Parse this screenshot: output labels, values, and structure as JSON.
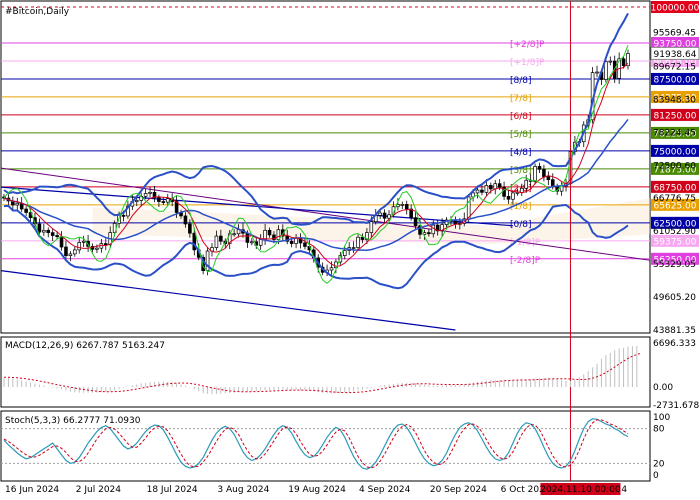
{
  "chart_data": [
    {
      "type": "candlestick",
      "title": "#Bitcoin,Daily",
      "yaxis_ticks": [
        43881.35,
        49605.2,
        55329.05,
        61052.9,
        66776.75,
        72500.6,
        78224.45,
        83948.3,
        89672.15,
        95569.45
      ],
      "current_price_label": "91938.64",
      "murrey_levels": [
        {
          "price": 100000.0,
          "label": "100000.00",
          "color": "#e0001b",
          "style": "dashed"
        },
        {
          "price": 93750.0,
          "label": "93750.00",
          "tag": "[+2/8]P",
          "color": "#e040e0"
        },
        {
          "price": 90625.0,
          "label": "90625.00",
          "tag": "[+1/8]P",
          "color": "#f7a8f0"
        },
        {
          "price": 87500.0,
          "label": "87500.00",
          "tag": "[8/8]",
          "color": "#0000a8"
        },
        {
          "price": 84375.0,
          "label": "84375.00",
          "tag": "[7/8]",
          "color": "#e8a000"
        },
        {
          "price": 81250.0,
          "label": "81250.00",
          "tag": "[6/8]",
          "color": "#d0001b"
        },
        {
          "price": 78125.0,
          "label": "78125.00",
          "tag": "[5/8]",
          "color": "#4a8a00"
        },
        {
          "price": 75000.0,
          "label": "75000.00",
          "tag": "[4/8]",
          "color": "#0000a8"
        },
        {
          "price": 71875.0,
          "label": "71875.00",
          "tag": "[3/8]",
          "color": "#4a8a00"
        },
        {
          "price": 68750.0,
          "label": "68750.00",
          "tag": "[2/8]",
          "color": "#d0001b"
        },
        {
          "price": 65625.0,
          "label": "65625.00",
          "tag": "[1/8]",
          "color": "#e8a000"
        },
        {
          "price": 62500.0,
          "label": "62500.00",
          "tag": "[0/8]",
          "color": "#0000a8"
        },
        {
          "price": 59375.0,
          "label": "59375.00",
          "tag": "[-1/8]P",
          "color": "#f7a8f0"
        },
        {
          "price": 56250.0,
          "label": "56250.00",
          "tag": "[-2/8]P",
          "color": "#e040e0"
        }
      ],
      "xaxis_labels": [
        "16 Jun 2024",
        "2 Jul 2024",
        "18 Jul 2024",
        "3 Aug 2024",
        "19 Aug 2024",
        "4 Sep 2024",
        "20 Sep 2024",
        "6 Oct 2024",
        "22 Oct 2024"
      ],
      "cursor_date_label": "2024.11.10 00:00",
      "series": [
        {
          "name": "close",
          "values": [
            66800,
            66300,
            65600,
            65900,
            64900,
            64300,
            63400,
            62300,
            60900,
            61200,
            60800,
            60300,
            60100,
            58300,
            56800,
            57100,
            57800,
            59100,
            59300,
            58400,
            57900,
            58100,
            58900,
            58700,
            60800,
            62400,
            63800,
            63700,
            65400,
            66200,
            66400,
            67100,
            67600,
            67800,
            66900,
            66200,
            66100,
            66700,
            66200,
            64300,
            63700,
            62300,
            60700,
            57800,
            56500,
            54200,
            57600,
            58200,
            60200,
            59300,
            58900,
            60600,
            60600,
            61300,
            60700,
            59100,
            59200,
            58600,
            59600,
            61200,
            60400,
            59600,
            61300,
            60200,
            59300,
            58900,
            59900,
            59000,
            58400,
            57800,
            56400,
            54800,
            53900,
            54300,
            54700,
            55700,
            56800,
            57700,
            58200,
            58200,
            60000,
            59600,
            60800,
            62700,
            63800,
            64200,
            63300,
            63900,
            65300,
            65700,
            65700,
            64900,
            63400,
            62000,
            60500,
            60800,
            60600,
            62100,
            61100,
            62200,
            63000,
            62800,
            62300,
            62400,
            63200,
            67000,
            67700,
            68200,
            67800,
            69000,
            68400,
            69300,
            68700,
            67100,
            66600,
            67700,
            67800,
            68500,
            69900,
            69700,
            72300,
            71800,
            70500,
            70000,
            68800,
            68000,
            68900,
            69300,
            74900,
            76500,
            76600,
            79500,
            80400,
            88600,
            88700,
            87400,
            90500,
            90600,
            87600,
            91000,
            89800,
            91938.64
          ]
        }
      ]
    },
    {
      "type": "line",
      "title": "MACD(12,26,9) 6267.787 5163.247",
      "yaxis_ticks": [
        6696.333,
        0.0,
        -2731.678
      ],
      "series": [
        {
          "name": "histogram",
          "values": [
            1400,
            1400,
            1300,
            1150,
            1000,
            850,
            700,
            550,
            350,
            200,
            50,
            -100,
            -200,
            -350,
            -550,
            -700,
            -800,
            -850,
            -850,
            -850,
            -850,
            -850,
            -800,
            -750,
            -650,
            -500,
            -300,
            -100,
            100,
            250,
            400,
            550,
            650,
            750,
            800,
            800,
            800,
            800,
            750,
            600,
            400,
            200,
            -50,
            -350,
            -650,
            -950,
            -1050,
            -1100,
            -1050,
            -1000,
            -950,
            -900,
            -850,
            -750,
            -700,
            -700,
            -650,
            -600,
            -550,
            -450,
            -450,
            -450,
            -400,
            -400,
            -400,
            -450,
            -450,
            -450,
            -500,
            -550,
            -650,
            -800,
            -900,
            -950,
            -950,
            -950,
            -900,
            -850,
            -750,
            -650,
            -500,
            -400,
            -250,
            -100,
            50,
            200,
            300,
            350,
            450,
            550,
            600,
            650,
            650,
            600,
            450,
            350,
            250,
            200,
            200,
            250,
            300,
            300,
            300,
            300,
            350,
            500,
            650,
            800,
            900,
            1000,
            1050,
            1100,
            1100,
            1100,
            1050,
            1050,
            1050,
            1050,
            1100,
            1200,
            1300,
            1350,
            1350,
            1350,
            1250,
            1150,
            1050,
            950,
            950,
            1100,
            1500,
            1950,
            2400,
            3000,
            3550,
            4300,
            4850,
            5200,
            5600,
            5850,
            5950,
            6150,
            6200,
            6267.787
          ]
        },
        {
          "name": "signal",
          "values": [
            1500,
            1480,
            1450,
            1400,
            1330,
            1250,
            1150,
            1050,
            920,
            780,
            640,
            500,
            360,
            220,
            100,
            -30,
            -150,
            -280,
            -380,
            -470,
            -560,
            -630,
            -680,
            -710,
            -720,
            -700,
            -660,
            -600,
            -520,
            -420,
            -300,
            -180,
            -60,
            60,
            180,
            300,
            400,
            480,
            550,
            600,
            620,
            600,
            550,
            450,
            330,
            180,
            20,
            -120,
            -260,
            -380,
            -490,
            -580,
            -650,
            -700,
            -720,
            -720,
            -710,
            -700,
            -680,
            -650,
            -620,
            -590,
            -560,
            -530,
            -500,
            -480,
            -470,
            -470,
            -480,
            -500,
            -530,
            -570,
            -620,
            -680,
            -740,
            -790,
            -830,
            -850,
            -850,
            -830,
            -790,
            -740,
            -660,
            -560,
            -450,
            -330,
            -200,
            -70,
            50,
            160,
            260,
            350,
            420,
            470,
            500,
            500,
            480,
            450,
            420,
            400,
            390,
            380,
            380,
            380,
            390,
            410,
            450,
            510,
            580,
            660,
            740,
            820,
            890,
            950,
            1000,
            1040,
            1060,
            1070,
            1080,
            1090,
            1110,
            1140,
            1180,
            1220,
            1250,
            1270,
            1270,
            1250,
            1220,
            1180,
            1150,
            1150,
            1200,
            1350,
            1550,
            1850,
            2200,
            2600,
            3050,
            3500,
            3950,
            4350,
            4700,
            4950,
            5163.247
          ]
        }
      ]
    },
    {
      "type": "line",
      "title": "Stoch(5,3,3) 66.2777 71.0930",
      "yaxis_ticks": [
        100,
        80,
        20,
        0
      ],
      "series": [
        {
          "name": "main",
          "values": [
            60,
            52,
            45,
            38,
            32,
            28,
            30,
            35,
            40,
            45,
            50,
            55,
            45,
            35,
            25,
            20,
            22,
            30,
            42,
            55,
            65,
            75,
            82,
            85,
            80,
            70,
            60,
            50,
            45,
            48,
            55,
            65,
            75,
            82,
            86,
            85,
            78,
            65,
            50,
            35,
            22,
            15,
            12,
            14,
            20,
            30,
            45,
            60,
            72,
            80,
            84,
            80,
            70,
            55,
            40,
            30,
            25,
            28,
            35,
            45,
            58,
            70,
            80,
            85,
            82,
            72,
            58,
            45,
            35,
            30,
            32,
            40,
            52,
            65,
            75,
            82,
            78,
            65,
            48,
            32,
            20,
            12,
            10,
            14,
            22,
            35,
            50,
            65,
            78,
            86,
            88,
            82,
            70,
            55,
            40,
            28,
            20,
            16,
            18,
            25,
            38,
            55,
            70,
            82,
            88,
            90,
            86,
            76,
            62,
            48,
            36,
            28,
            25,
            28,
            38,
            55,
            72,
            84,
            90,
            88,
            80,
            65,
            48,
            32,
            20,
            14,
            12,
            15,
            25,
            42,
            62,
            80,
            92,
            97,
            96,
            92,
            88,
            85,
            80,
            76,
            70,
            66.2777
          ]
        },
        {
          "name": "signal",
          "values": [
            62,
            58,
            52,
            46,
            40,
            35,
            31,
            31,
            34,
            39,
            44,
            49,
            50,
            46,
            39,
            30,
            24,
            23,
            28,
            38,
            50,
            62,
            72,
            80,
            82,
            79,
            72,
            63,
            54,
            48,
            48,
            55,
            64,
            74,
            81,
            84,
            83,
            76,
            64,
            50,
            36,
            24,
            16,
            14,
            15,
            22,
            32,
            45,
            58,
            70,
            79,
            82,
            79,
            70,
            55,
            42,
            32,
            28,
            29,
            36,
            47,
            59,
            71,
            80,
            83,
            80,
            71,
            58,
            46,
            36,
            32,
            34,
            41,
            52,
            64,
            74,
            79,
            76,
            64,
            48,
            32,
            21,
            14,
            12,
            15,
            24,
            36,
            50,
            64,
            76,
            84,
            87,
            83,
            73,
            58,
            42,
            30,
            22,
            18,
            19,
            26,
            39,
            54,
            69,
            80,
            87,
            88,
            84,
            74,
            61,
            48,
            37,
            30,
            27,
            30,
            40,
            55,
            70,
            81,
            87,
            86,
            78,
            64,
            48,
            33,
            22,
            15,
            14,
            17,
            27,
            43,
            62,
            79,
            90,
            95,
            95,
            92,
            88,
            85,
            81,
            76,
            71.093
          ]
        }
      ]
    }
  ]
}
